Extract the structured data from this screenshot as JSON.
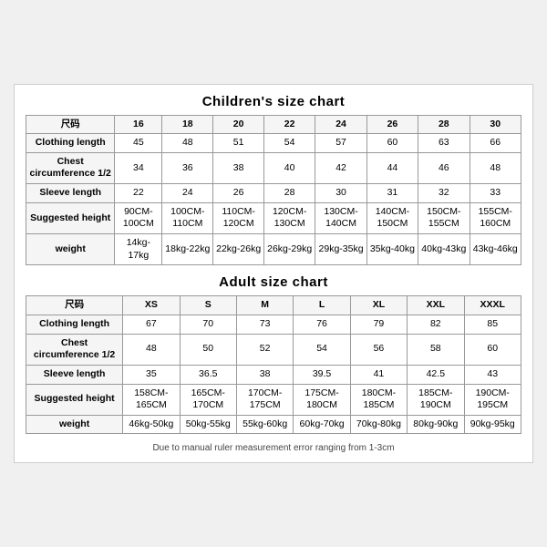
{
  "children_title": "Children's size chart",
  "adult_title": "Adult size chart",
  "note": "Due to manual ruler measurement error ranging from 1-3cm",
  "children": {
    "headers": [
      "尺码",
      "16",
      "18",
      "20",
      "22",
      "24",
      "26",
      "28",
      "30"
    ],
    "rows": [
      {
        "label": "Clothing length",
        "values": [
          "45",
          "48",
          "51",
          "54",
          "57",
          "60",
          "63",
          "66"
        ]
      },
      {
        "label": "Chest circumference 1/2",
        "values": [
          "34",
          "36",
          "38",
          "40",
          "42",
          "44",
          "46",
          "48"
        ]
      },
      {
        "label": "Sleeve length",
        "values": [
          "22",
          "24",
          "26",
          "28",
          "30",
          "31",
          "32",
          "33"
        ]
      },
      {
        "label": "Suggested height",
        "values": [
          "90CM-100CM",
          "100CM-110CM",
          "110CM-120CM",
          "120CM-130CM",
          "130CM-140CM",
          "140CM-150CM",
          "150CM-155CM",
          "155CM-160CM"
        ]
      },
      {
        "label": "weight",
        "values": [
          "14kg-17kg",
          "18kg-22kg",
          "22kg-26kg",
          "26kg-29kg",
          "29kg-35kg",
          "35kg-40kg",
          "40kg-43kg",
          "43kg-46kg"
        ]
      }
    ]
  },
  "adult": {
    "headers": [
      "尺码",
      "XS",
      "S",
      "M",
      "L",
      "XL",
      "XXL",
      "XXXL"
    ],
    "rows": [
      {
        "label": "Clothing length",
        "values": [
          "67",
          "70",
          "73",
          "76",
          "79",
          "82",
          "85"
        ]
      },
      {
        "label": "Chest circumference 1/2",
        "values": [
          "48",
          "50",
          "52",
          "54",
          "56",
          "58",
          "60"
        ]
      },
      {
        "label": "Sleeve length",
        "values": [
          "35",
          "36.5",
          "38",
          "39.5",
          "41",
          "42.5",
          "43"
        ]
      },
      {
        "label": "Suggested height",
        "values": [
          "158CM-165CM",
          "165CM-170CM",
          "170CM-175CM",
          "175CM-180CM",
          "180CM-185CM",
          "185CM-190CM",
          "190CM-195CM"
        ]
      },
      {
        "label": "weight",
        "values": [
          "46kg-50kg",
          "50kg-55kg",
          "55kg-60kg",
          "60kg-70kg",
          "70kg-80kg",
          "80kg-90kg",
          "90kg-95kg"
        ]
      }
    ]
  }
}
